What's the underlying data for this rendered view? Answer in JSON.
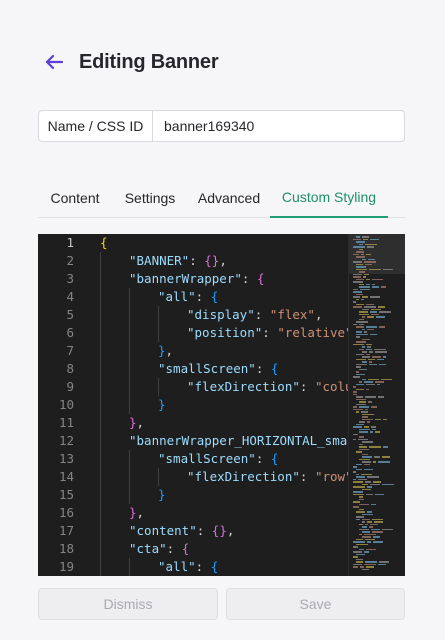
{
  "header": {
    "back_icon": "arrow-left-icon",
    "accent": "#5b3fd6",
    "title": "Editing Banner"
  },
  "name_field": {
    "label": "Name / CSS ID",
    "value": "banner169340"
  },
  "tabs": [
    {
      "label": "Content",
      "active": false
    },
    {
      "label": "Settings",
      "active": false
    },
    {
      "label": "Advanced",
      "active": false
    },
    {
      "label": "Custom Styling",
      "active": true
    }
  ],
  "active_tab_color": "#1f9e73",
  "editor": {
    "current_line": 1,
    "lines": [
      {
        "n": "1",
        "indent": 0,
        "tokens": [
          [
            "b1",
            "{"
          ]
        ]
      },
      {
        "n": "2",
        "indent": 1,
        "tokens": [
          [
            "k",
            "\"BANNER\""
          ],
          [
            "p",
            ": "
          ],
          [
            "b2",
            "{}"
          ],
          [
            "p",
            ","
          ]
        ]
      },
      {
        "n": "3",
        "indent": 1,
        "tokens": [
          [
            "k",
            "\"bannerWrapper\""
          ],
          [
            "p",
            ": "
          ],
          [
            "b2",
            "{"
          ]
        ]
      },
      {
        "n": "4",
        "indent": 2,
        "tokens": [
          [
            "k",
            "\"all\""
          ],
          [
            "p",
            ": "
          ],
          [
            "b3",
            "{"
          ]
        ]
      },
      {
        "n": "5",
        "indent": 3,
        "tokens": [
          [
            "k",
            "\"display\""
          ],
          [
            "p",
            ": "
          ],
          [
            "s",
            "\"flex\""
          ],
          [
            "p",
            ","
          ]
        ]
      },
      {
        "n": "6",
        "indent": 3,
        "tokens": [
          [
            "k",
            "\"position\""
          ],
          [
            "p",
            ": "
          ],
          [
            "s",
            "\"relative\""
          ]
        ]
      },
      {
        "n": "7",
        "indent": 2,
        "tokens": [
          [
            "b3",
            "}"
          ],
          [
            "p",
            ","
          ]
        ]
      },
      {
        "n": "8",
        "indent": 2,
        "tokens": [
          [
            "k",
            "\"smallScreen\""
          ],
          [
            "p",
            ": "
          ],
          [
            "b3",
            "{"
          ]
        ]
      },
      {
        "n": "9",
        "indent": 3,
        "tokens": [
          [
            "k",
            "\"flexDirection\""
          ],
          [
            "p",
            ": "
          ],
          [
            "s",
            "\"colum"
          ]
        ]
      },
      {
        "n": "10",
        "indent": 2,
        "tokens": [
          [
            "b3",
            "}"
          ]
        ]
      },
      {
        "n": "11",
        "indent": 1,
        "tokens": [
          [
            "b2",
            "}"
          ],
          [
            "p",
            ","
          ]
        ]
      },
      {
        "n": "12",
        "indent": 1,
        "tokens": [
          [
            "k",
            "\"bannerWrapper_HORIZONTAL_smal"
          ]
        ]
      },
      {
        "n": "13",
        "indent": 2,
        "tokens": [
          [
            "k",
            "\"smallScreen\""
          ],
          [
            "p",
            ": "
          ],
          [
            "b3",
            "{"
          ]
        ]
      },
      {
        "n": "14",
        "indent": 3,
        "tokens": [
          [
            "k",
            "\"flexDirection\""
          ],
          [
            "p",
            ": "
          ],
          [
            "s",
            "\"row\""
          ]
        ]
      },
      {
        "n": "15",
        "indent": 2,
        "tokens": [
          [
            "b3",
            "}"
          ]
        ]
      },
      {
        "n": "16",
        "indent": 1,
        "tokens": [
          [
            "b2",
            "}"
          ],
          [
            "p",
            ","
          ]
        ]
      },
      {
        "n": "17",
        "indent": 1,
        "tokens": [
          [
            "k",
            "\"content\""
          ],
          [
            "p",
            ": "
          ],
          [
            "b2",
            "{}"
          ],
          [
            "p",
            ","
          ]
        ]
      },
      {
        "n": "18",
        "indent": 1,
        "tokens": [
          [
            "k",
            "\"cta\""
          ],
          [
            "p",
            ": "
          ],
          [
            "b2",
            "{"
          ]
        ]
      },
      {
        "n": "19",
        "indent": 2,
        "tokens": [
          [
            "k",
            "\"all\""
          ],
          [
            "p",
            ": "
          ],
          [
            "b3",
            "{"
          ]
        ]
      }
    ]
  },
  "footer": {
    "dismiss_label": "Dismiss",
    "save_label": "Save"
  }
}
